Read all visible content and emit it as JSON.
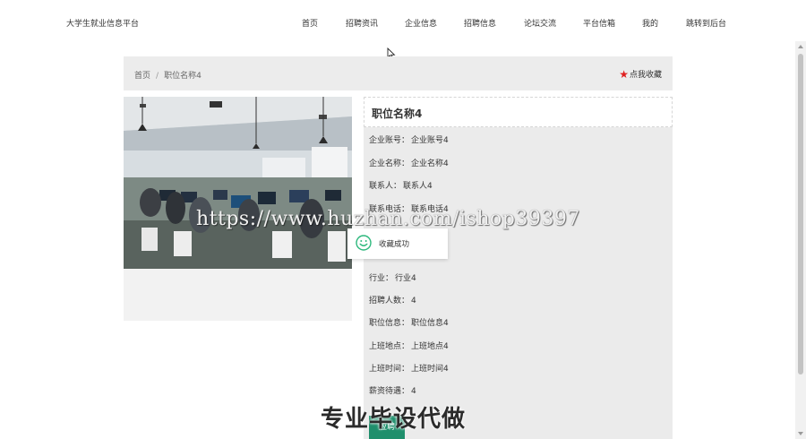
{
  "brand": "大学生就业信息平台",
  "nav": [
    {
      "label": "首页"
    },
    {
      "label": "招聘资讯"
    },
    {
      "label": "企业信息"
    },
    {
      "label": "招聘信息"
    },
    {
      "label": "论坛交流"
    },
    {
      "label": "平台信箱"
    },
    {
      "label": "我的"
    },
    {
      "label": "跳转到后台"
    }
  ],
  "breadcrumb": {
    "home": "首页",
    "separator": "/",
    "current": "职位名称4"
  },
  "favorite": {
    "label": "点我收藏",
    "icon": "star-icon",
    "color": "#e02020"
  },
  "job": {
    "title": "职位名称4",
    "fields": [
      {
        "label": "企业账号：",
        "value": "企业账号4"
      },
      {
        "label": "企业名称：",
        "value": "企业名称4"
      },
      {
        "label": "联系人：",
        "value": "联系人4"
      },
      {
        "label": "联系电话：",
        "value": "联系电话4"
      },
      {
        "label": "行业：",
        "value": "行业4"
      },
      {
        "label": "招聘人数：",
        "value": "4"
      },
      {
        "label": "职位信息：",
        "value": "职位信息4"
      },
      {
        "label": "上班地点：",
        "value": "上班地点4"
      },
      {
        "label": "上班时间：",
        "value": "上班时间4"
      },
      {
        "label": "薪资待遇：",
        "value": "4"
      }
    ]
  },
  "toast": {
    "text": "收藏成功",
    "icon": "smile-icon",
    "color": "#2db87d"
  },
  "button": {
    "label": "应聘",
    "color": "#1f8f6c"
  },
  "watermark": "https://www.huzhan.com/ishop39397",
  "overlay": "专业毕设代做"
}
